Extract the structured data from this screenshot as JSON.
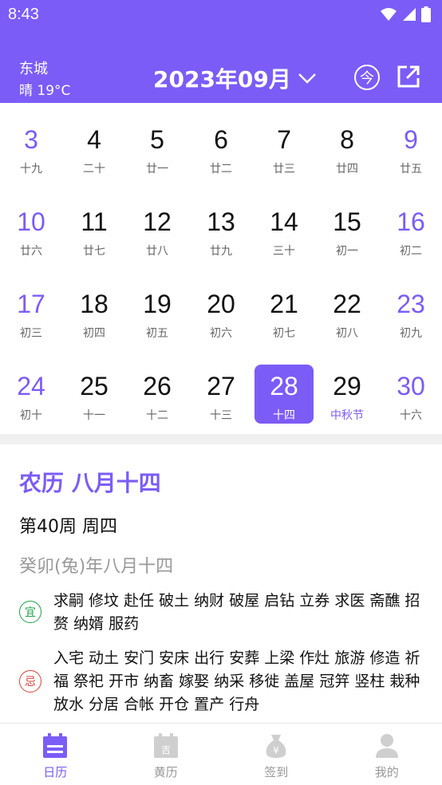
{
  "status_bar": {
    "time": "8:43"
  },
  "header": {
    "location": "东城",
    "weather": "晴 19°C",
    "month_title": "2023年09月",
    "today_label": "今"
  },
  "colors": {
    "accent": "#7B5CF7",
    "yi": "#22a04b",
    "ji": "#d8403a"
  },
  "calendar": {
    "rows": [
      [
        {
          "n": "3",
          "l": "十九"
        },
        {
          "n": "4",
          "l": "二十"
        },
        {
          "n": "5",
          "l": "廿一"
        },
        {
          "n": "6",
          "l": "廿二"
        },
        {
          "n": "7",
          "l": "廿三"
        },
        {
          "n": "8",
          "l": "廿四"
        },
        {
          "n": "9",
          "l": "廿五"
        }
      ],
      [
        {
          "n": "10",
          "l": "廿六"
        },
        {
          "n": "11",
          "l": "廿七"
        },
        {
          "n": "12",
          "l": "廿八"
        },
        {
          "n": "13",
          "l": "廿九"
        },
        {
          "n": "14",
          "l": "三十"
        },
        {
          "n": "15",
          "l": "初一"
        },
        {
          "n": "16",
          "l": "初二"
        }
      ],
      [
        {
          "n": "17",
          "l": "初三"
        },
        {
          "n": "18",
          "l": "初四"
        },
        {
          "n": "19",
          "l": "初五"
        },
        {
          "n": "20",
          "l": "初六"
        },
        {
          "n": "21",
          "l": "初七"
        },
        {
          "n": "22",
          "l": "初八"
        },
        {
          "n": "23",
          "l": "初九"
        }
      ],
      [
        {
          "n": "24",
          "l": "初十"
        },
        {
          "n": "25",
          "l": "十一"
        },
        {
          "n": "26",
          "l": "十二"
        },
        {
          "n": "27",
          "l": "十三"
        },
        {
          "n": "28",
          "l": "十四",
          "selected": true
        },
        {
          "n": "29",
          "l": "中秋节",
          "festival": true
        },
        {
          "n": "30",
          "l": "十六"
        }
      ]
    ]
  },
  "details": {
    "lunar_title": "农历 八月十四",
    "week_line": "第40周 周四",
    "ganzhi": "癸卯(兔)年八月十四",
    "yi_label": "宜",
    "yi_items": "求嗣 修坟 赴任 破土 纳财 破屋 启钻 立券 求医 斋醮 招赘 纳婿 服药",
    "ji_label": "忌",
    "ji_items": "入宅 动土 安门 安床 出行 安葬 上梁 作灶 旅游 修造 祈福 祭祀 开市 纳畜 嫁娶 纳采 移徙 盖屋 冠笄 竖柱 栽种 放水 分居 合帐 开仓 置产 行舟"
  },
  "bottom_nav": [
    {
      "label": "日历",
      "icon": "calendar-icon",
      "active": true
    },
    {
      "label": "黄历",
      "icon": "almanac-icon",
      "active": false
    },
    {
      "label": "签到",
      "icon": "money-bag-icon",
      "active": false
    },
    {
      "label": "我的",
      "icon": "profile-icon",
      "active": false
    }
  ]
}
